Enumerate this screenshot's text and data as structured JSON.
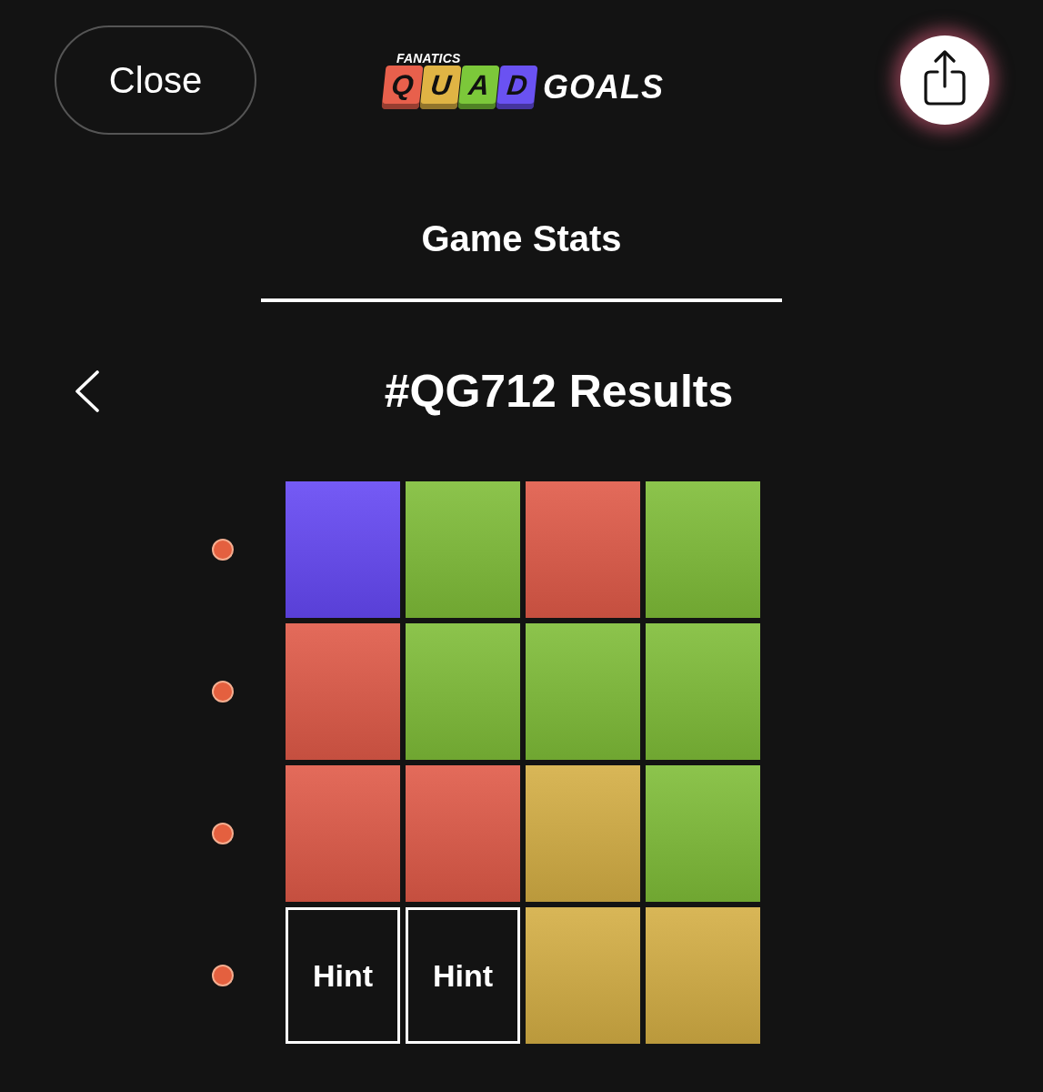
{
  "header": {
    "close_button": "Close",
    "logo": {
      "brand": "FANATICS",
      "tiles": [
        {
          "letter": "Q",
          "color": "#e8604c"
        },
        {
          "letter": "U",
          "color": "#e0b444"
        },
        {
          "letter": "A",
          "color": "#7cc83a"
        },
        {
          "letter": "D",
          "color": "#6a52f2"
        }
      ],
      "word": "GOALS"
    }
  },
  "tabs": [
    {
      "label": "Game Stats",
      "selected": true
    }
  ],
  "results": {
    "title": "#QG712 Results",
    "rows": [
      {
        "cells": [
          {
            "kind": "tile",
            "color": "#6548f4"
          },
          {
            "kind": "tile",
            "color": "#7fbd38"
          },
          {
            "kind": "tile",
            "color": "#e05a48"
          },
          {
            "kind": "tile",
            "color": "#7fbd38"
          }
        ]
      },
      {
        "cells": [
          {
            "kind": "tile",
            "color": "#e05a48"
          },
          {
            "kind": "tile",
            "color": "#7fbd38"
          },
          {
            "kind": "tile",
            "color": "#7fbd38"
          },
          {
            "kind": "tile",
            "color": "#7fbd38"
          }
        ]
      },
      {
        "cells": [
          {
            "kind": "tile",
            "color": "#e05a48"
          },
          {
            "kind": "tile",
            "color": "#e05a48"
          },
          {
            "kind": "tile",
            "color": "#d4ae44"
          },
          {
            "kind": "tile",
            "color": "#7fbd38"
          }
        ]
      },
      {
        "cells": [
          {
            "kind": "hint",
            "label": "Hint"
          },
          {
            "kind": "hint",
            "label": "Hint"
          },
          {
            "kind": "tile",
            "color": "#d4ae44"
          },
          {
            "kind": "tile",
            "color": "#d4ae44"
          }
        ]
      }
    ]
  }
}
